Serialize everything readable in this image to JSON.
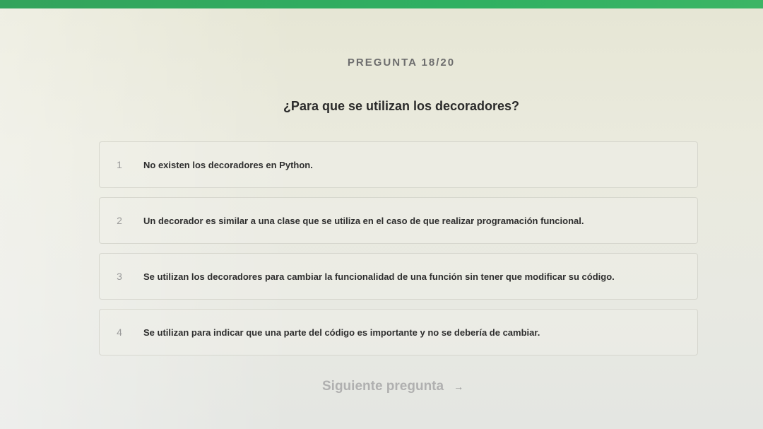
{
  "header": {
    "question_counter": "PREGUNTA 18/20"
  },
  "question": {
    "title": "¿Para que se utilizan los decoradores?"
  },
  "options": [
    {
      "number": "1",
      "text": "No existen los decoradores en Python."
    },
    {
      "number": "2",
      "text": "Un decorador es similar a una clase que se utiliza en el caso de que realizar programación funcional."
    },
    {
      "number": "3",
      "text": "Se utilizan los decoradores para cambiar la funcionalidad de una función sin tener que modificar su código."
    },
    {
      "number": "4",
      "text": "Se utilizan para indicar que una parte del código es importante y no se debería de cambiar."
    }
  ],
  "footer": {
    "next_label": "Siguiente pregunta",
    "next_icon": "arrow-right-icon"
  },
  "colors": {
    "accent_bar": "#2fb062",
    "text_primary": "#2a2a2a",
    "text_muted": "#b0b0b0"
  }
}
